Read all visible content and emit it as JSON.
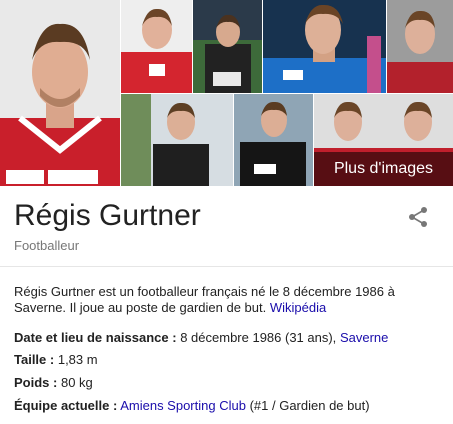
{
  "images": {
    "more_label": "Plus d'images"
  },
  "entity": {
    "name": "Régis Gurtner",
    "type": "Footballeur"
  },
  "description": {
    "text": "Régis Gurtner est un footballeur français né le 8 décembre 1986 à Saverne. Il joue au poste de gardien de but.",
    "source_link": "Wikipédia"
  },
  "facts": {
    "birth": {
      "label": "Date et lieu de naissance :",
      "value": "8 décembre 1986 (31 ans),",
      "link": "Saverne"
    },
    "height": {
      "label": "Taille :",
      "value": "1,83 m"
    },
    "weight": {
      "label": "Poids :",
      "value": "80 kg"
    },
    "team": {
      "label": "Équipe actuelle :",
      "link": "Amiens Sporting Club",
      "value": "(#1 / Gardien de but)"
    }
  },
  "colors": {
    "link": "#1a0dab",
    "title": "#222222",
    "subtitle": "#777777"
  },
  "icons": {
    "share": "share-icon"
  }
}
